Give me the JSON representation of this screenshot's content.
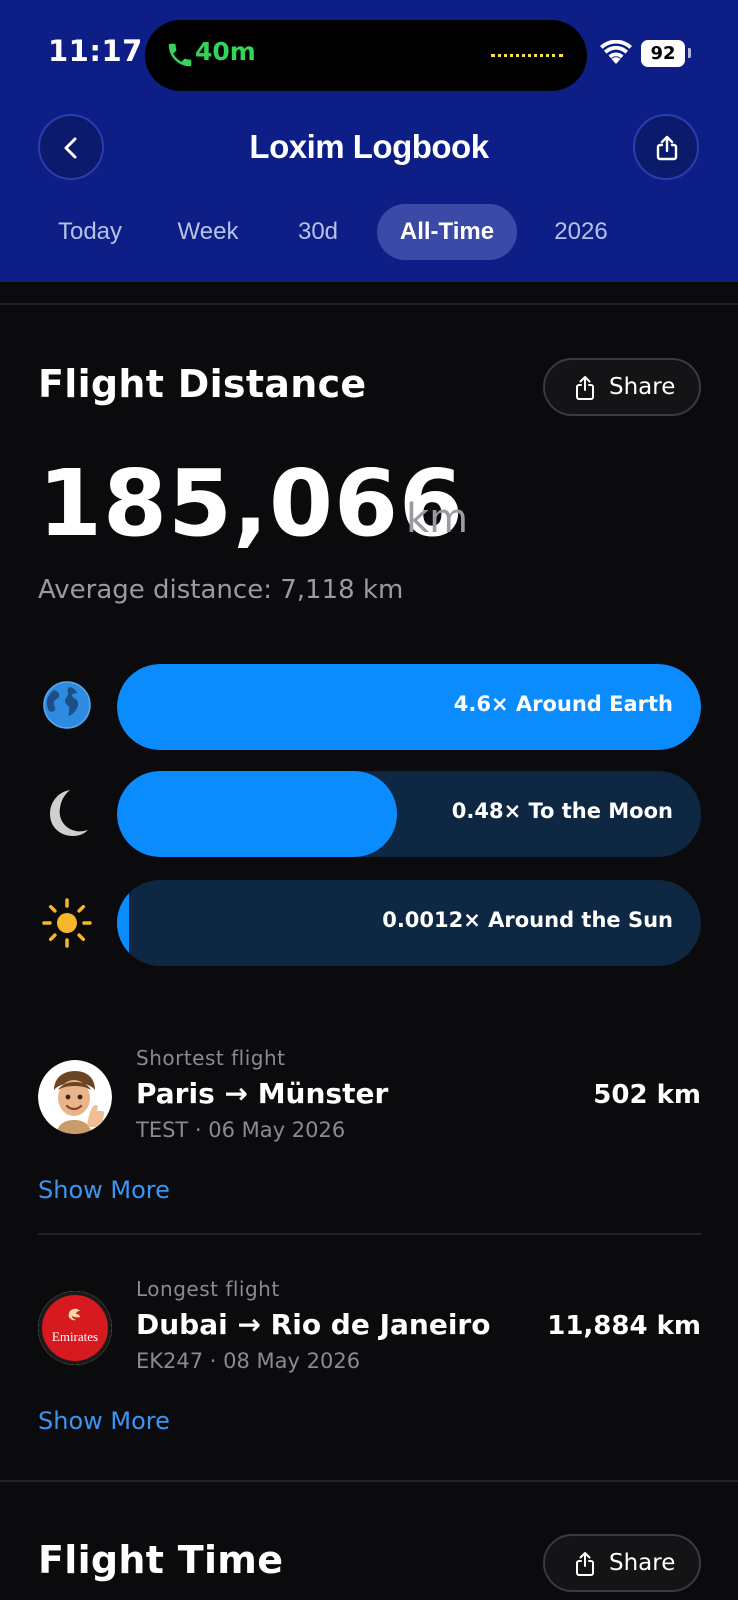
{
  "status_bar": {
    "time": "11:17",
    "call_duration": "40m",
    "battery": "92"
  },
  "header": {
    "title": "Loxim Logbook",
    "tabs": [
      {
        "label": "Today",
        "active": false
      },
      {
        "label": "Week",
        "active": false
      },
      {
        "label": "30d",
        "active": false
      },
      {
        "label": "All-Time",
        "active": true
      },
      {
        "label": "2026",
        "active": false
      }
    ]
  },
  "flight_distance": {
    "title": "Flight Distance",
    "share_label": "Share",
    "total": "185,066",
    "unit": "km",
    "average": "Average distance: 7,118 km",
    "comparisons": [
      {
        "icon": "globe-icon",
        "label": "4.6× Around Earth",
        "fill_fraction": 1.0
      },
      {
        "icon": "moon-icon",
        "label": "0.48× To the Moon",
        "fill_fraction": 0.48
      },
      {
        "icon": "sun-icon",
        "label": "0.0012× Around the Sun",
        "fill_fraction": 0.0012
      }
    ]
  },
  "shortest_flight": {
    "caption": "Shortest flight",
    "route": "Paris → Münster",
    "meta": "TEST · 06 May 2026",
    "distance": "502 km",
    "show_more": "Show More"
  },
  "longest_flight": {
    "caption": "Longest flight",
    "route": "Dubai → Rio de Janeiro",
    "meta": "EK247 · 08 May 2026",
    "distance": "11,884 km",
    "airline_logo_text": "Emirates",
    "show_more": "Show More"
  },
  "flight_time": {
    "title": "Flight Time",
    "share_label": "Share"
  },
  "colors": {
    "header_bg": "#0d1f86",
    "accent_blue": "#0a8cff",
    "link_blue": "#3a95f5",
    "page_bg": "#0b0b0d"
  }
}
